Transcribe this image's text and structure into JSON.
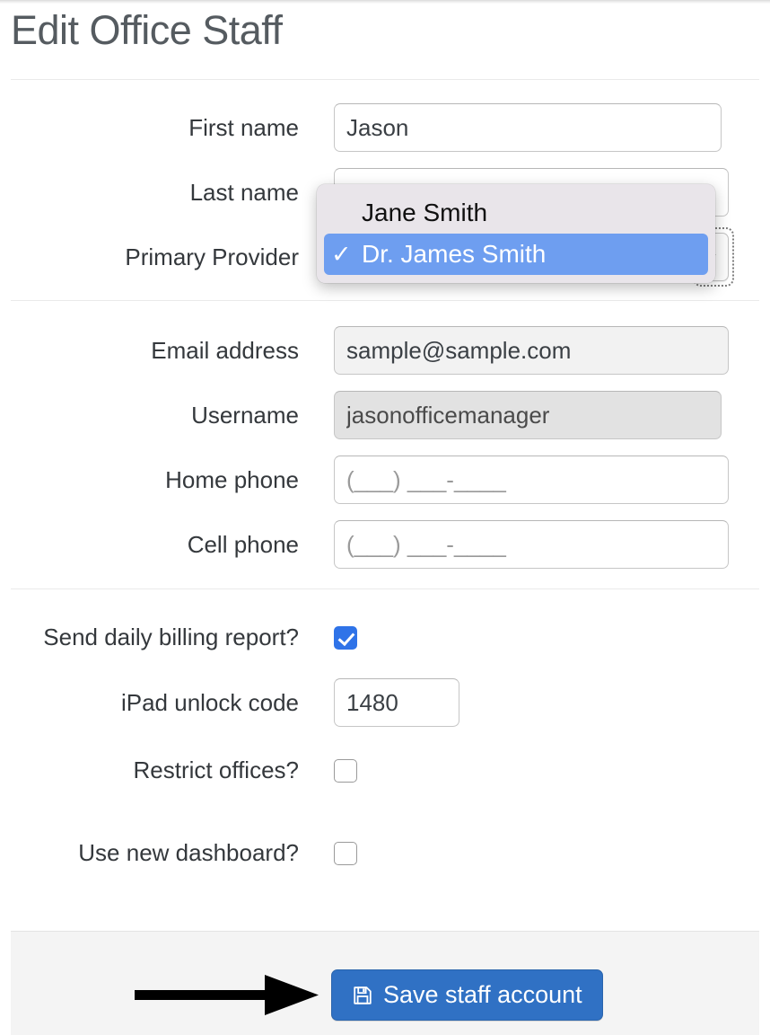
{
  "header": {
    "title": "Edit Office Staff"
  },
  "form": {
    "fields": [
      {
        "label": "First name",
        "value": "Jason",
        "placeholder": ""
      },
      {
        "label": "Last name",
        "value": "",
        "placeholder": ""
      },
      {
        "label": "Primary Provider",
        "value": "Dr. James Smith",
        "placeholder": ""
      },
      {
        "label": "Email address",
        "value": "sample@sample.com",
        "placeholder": ""
      },
      {
        "label": "Username",
        "value": "jasonofficemanager",
        "placeholder": ""
      },
      {
        "label": "Home phone",
        "value": "",
        "placeholder": "(___) ___-____"
      },
      {
        "label": "Cell phone",
        "value": "",
        "placeholder": "(___) ___-____"
      }
    ],
    "options": [
      {
        "label": "Send daily billing report?",
        "checked": true
      },
      {
        "label": "iPad unlock code",
        "value": "1480"
      },
      {
        "label": "Restrict offices?",
        "checked": false
      },
      {
        "label": "Use new dashboard?",
        "checked": false
      }
    ]
  },
  "dropdown": {
    "open": true,
    "items": [
      {
        "label": "Jane Smith",
        "selected": false,
        "check": ""
      },
      {
        "label": "Dr. James Smith",
        "selected": true,
        "check": "✓"
      }
    ]
  },
  "footer": {
    "save_label": "Save staff account",
    "save_icon": "save-floppy-icon"
  },
  "annotation": {
    "arrow": "right-arrow-annotation"
  },
  "colors": {
    "accent_blue": "#3071c4",
    "checkbox_blue": "#2f73e8",
    "highlight_blue": "#6e9ef0",
    "popup_bg": "#e9e5ea",
    "footer_bg": "#f4f4f4",
    "title_gray": "#555b60"
  }
}
